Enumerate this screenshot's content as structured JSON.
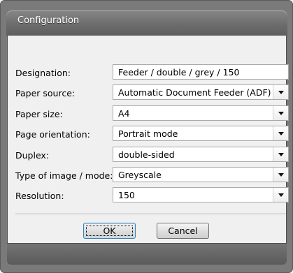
{
  "window": {
    "title": "Configuration"
  },
  "form": {
    "rows": [
      {
        "label": "Designation:",
        "value": "Feeder / double / grey / 150",
        "control": "text"
      },
      {
        "label": "Paper source:",
        "value": "Automatic Document Feeder (ADF)",
        "control": "dropdown"
      },
      {
        "label": "Paper size:",
        "value": "A4",
        "control": "dropdown"
      },
      {
        "label": "Page orientation:",
        "value": "Portrait mode",
        "control": "dropdown"
      },
      {
        "label": "Duplex:",
        "value": "double-sided",
        "control": "dropdown"
      },
      {
        "label": "Type of image / mode:",
        "value": "Greyscale",
        "control": "dropdown"
      },
      {
        "label": "Resolution:",
        "value": "150",
        "control": "dropdown"
      }
    ]
  },
  "buttons": {
    "ok_label": "OK",
    "cancel_label": "Cancel"
  },
  "colors": {
    "frame": "#7a7a7a",
    "client": "#f0f0f0",
    "field_border": "#a9a9a9",
    "default_button_border": "#3c7fb1"
  }
}
